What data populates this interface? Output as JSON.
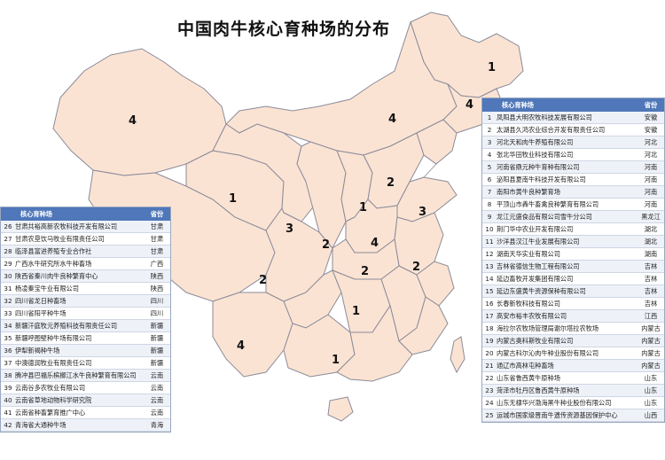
{
  "title": "中国肉牛核心育种场的分布",
  "map_labels": [
    "1",
    "4",
    "4",
    "4",
    "1",
    "2",
    "1",
    "3",
    "3",
    "2",
    "4",
    "2",
    "2",
    "2",
    "1",
    "4",
    "1"
  ],
  "left_table": {
    "headers": {
      "name": "核心育种场",
      "province": "省份"
    },
    "rows": [
      {
        "no": "26",
        "name": "甘肃共裕高新农牧科技开发有限公司",
        "province": "甘肃"
      },
      {
        "no": "27",
        "name": "甘肃农垦饮马牧业有限责任公司",
        "province": "甘肃"
      },
      {
        "no": "28",
        "name": "临泽县富进养殖专业合作社",
        "province": "甘肃"
      },
      {
        "no": "29",
        "name": "广西水牛研究所水牛种畜场",
        "province": "广西"
      },
      {
        "no": "30",
        "name": "陕西省秦川肉牛良种繁育中心",
        "province": "陕西"
      },
      {
        "no": "31",
        "name": "杨凌秦宝牛业有限公司",
        "province": "陕西"
      },
      {
        "no": "32",
        "name": "四川省龙日种畜场",
        "province": "四川"
      },
      {
        "no": "33",
        "name": "四川省阳平种牛场",
        "province": "四川"
      },
      {
        "no": "34",
        "name": "新疆汗庭牧元养殖科技有限责任公司",
        "province": "新疆"
      },
      {
        "no": "35",
        "name": "新疆呼图壁种牛场有限公司",
        "province": "新疆"
      },
      {
        "no": "36",
        "name": "伊犁新褐种牛场",
        "province": "新疆"
      },
      {
        "no": "37",
        "name": "中澳德润牧业有限责任公司",
        "province": "新疆"
      },
      {
        "no": "38",
        "name": "腾冲县巴福乐槟榔江水牛良种繁育有限公司",
        "province": "云南"
      },
      {
        "no": "39",
        "name": "云南谷多农牧业有限公司",
        "province": "云南"
      },
      {
        "no": "40",
        "name": "云南省草地动物科学研究院",
        "province": "云南"
      },
      {
        "no": "41",
        "name": "云南省种畜繁育推广中心",
        "province": "云南"
      },
      {
        "no": "42",
        "name": "青海省大通种牛场",
        "province": "青海"
      }
    ]
  },
  "right_table": {
    "headers": {
      "name": "核心育种场",
      "province": "省份"
    },
    "rows": [
      {
        "no": "1",
        "name": "凤阳县大明农牧科技发展有限公司",
        "province": "安徽"
      },
      {
        "no": "2",
        "name": "太湖县久鸿农业综合开发有限责任公司",
        "province": "安徽"
      },
      {
        "no": "3",
        "name": "河北天和肉牛养殖有限公司",
        "province": "河北"
      },
      {
        "no": "4",
        "name": "张北华田牧业科技有限公司",
        "province": "河北"
      },
      {
        "no": "5",
        "name": "河南省鼎元种牛育种有限公司",
        "province": "河南"
      },
      {
        "no": "6",
        "name": "泌阳县夏南牛科技开发有限公司",
        "province": "河南"
      },
      {
        "no": "7",
        "name": "南阳市黄牛良种繁育场",
        "province": "河南"
      },
      {
        "no": "8",
        "name": "平顶山市羴牛畜禽良种繁育有限公司",
        "province": "河南"
      },
      {
        "no": "9",
        "name": "龙江元盛食品有限公司雪牛分公司",
        "province": "黑龙江"
      },
      {
        "no": "10",
        "name": "荆门华中农业开发有限公司",
        "province": "湖北"
      },
      {
        "no": "11",
        "name": "沙洋县汉江牛业发展有限公司",
        "province": "湖北"
      },
      {
        "no": "12",
        "name": "湖南天华实业有限公司",
        "province": "湖南"
      },
      {
        "no": "13",
        "name": "吉林省德信生物工程有限公司",
        "province": "吉林"
      },
      {
        "no": "14",
        "name": "延边畜牧开发集团有限公司",
        "province": "吉林"
      },
      {
        "no": "15",
        "name": "延边东盛黄牛资源保种有限公司",
        "province": "吉林"
      },
      {
        "no": "16",
        "name": "长春新牧科技有限公司",
        "province": "吉林"
      },
      {
        "no": "17",
        "name": "高安市裕丰农牧有限公司",
        "province": "江西"
      },
      {
        "no": "18",
        "name": "海拉尔农牧场管理局谢尔塔拉农牧场",
        "province": "内蒙古"
      },
      {
        "no": "19",
        "name": "内蒙古奥科斯牧业有限公司",
        "province": "内蒙古"
      },
      {
        "no": "20",
        "name": "内蒙古科尔沁肉牛种业股份有限公司",
        "province": "内蒙古"
      },
      {
        "no": "21",
        "name": "通辽市高林屯种畜场",
        "province": "内蒙古"
      },
      {
        "no": "22",
        "name": "山东省鲁西黄牛原种场",
        "province": "山东"
      },
      {
        "no": "23",
        "name": "菏泽市牡丹区鲁西黄牛原种场",
        "province": "山东"
      },
      {
        "no": "24",
        "name": "山东无棣华兴渤海黑牛种业股份有限公司",
        "province": "山东"
      },
      {
        "no": "25",
        "name": "运城市国家级晋南牛遗传资源基因保护中心",
        "province": "山西"
      }
    ]
  }
}
